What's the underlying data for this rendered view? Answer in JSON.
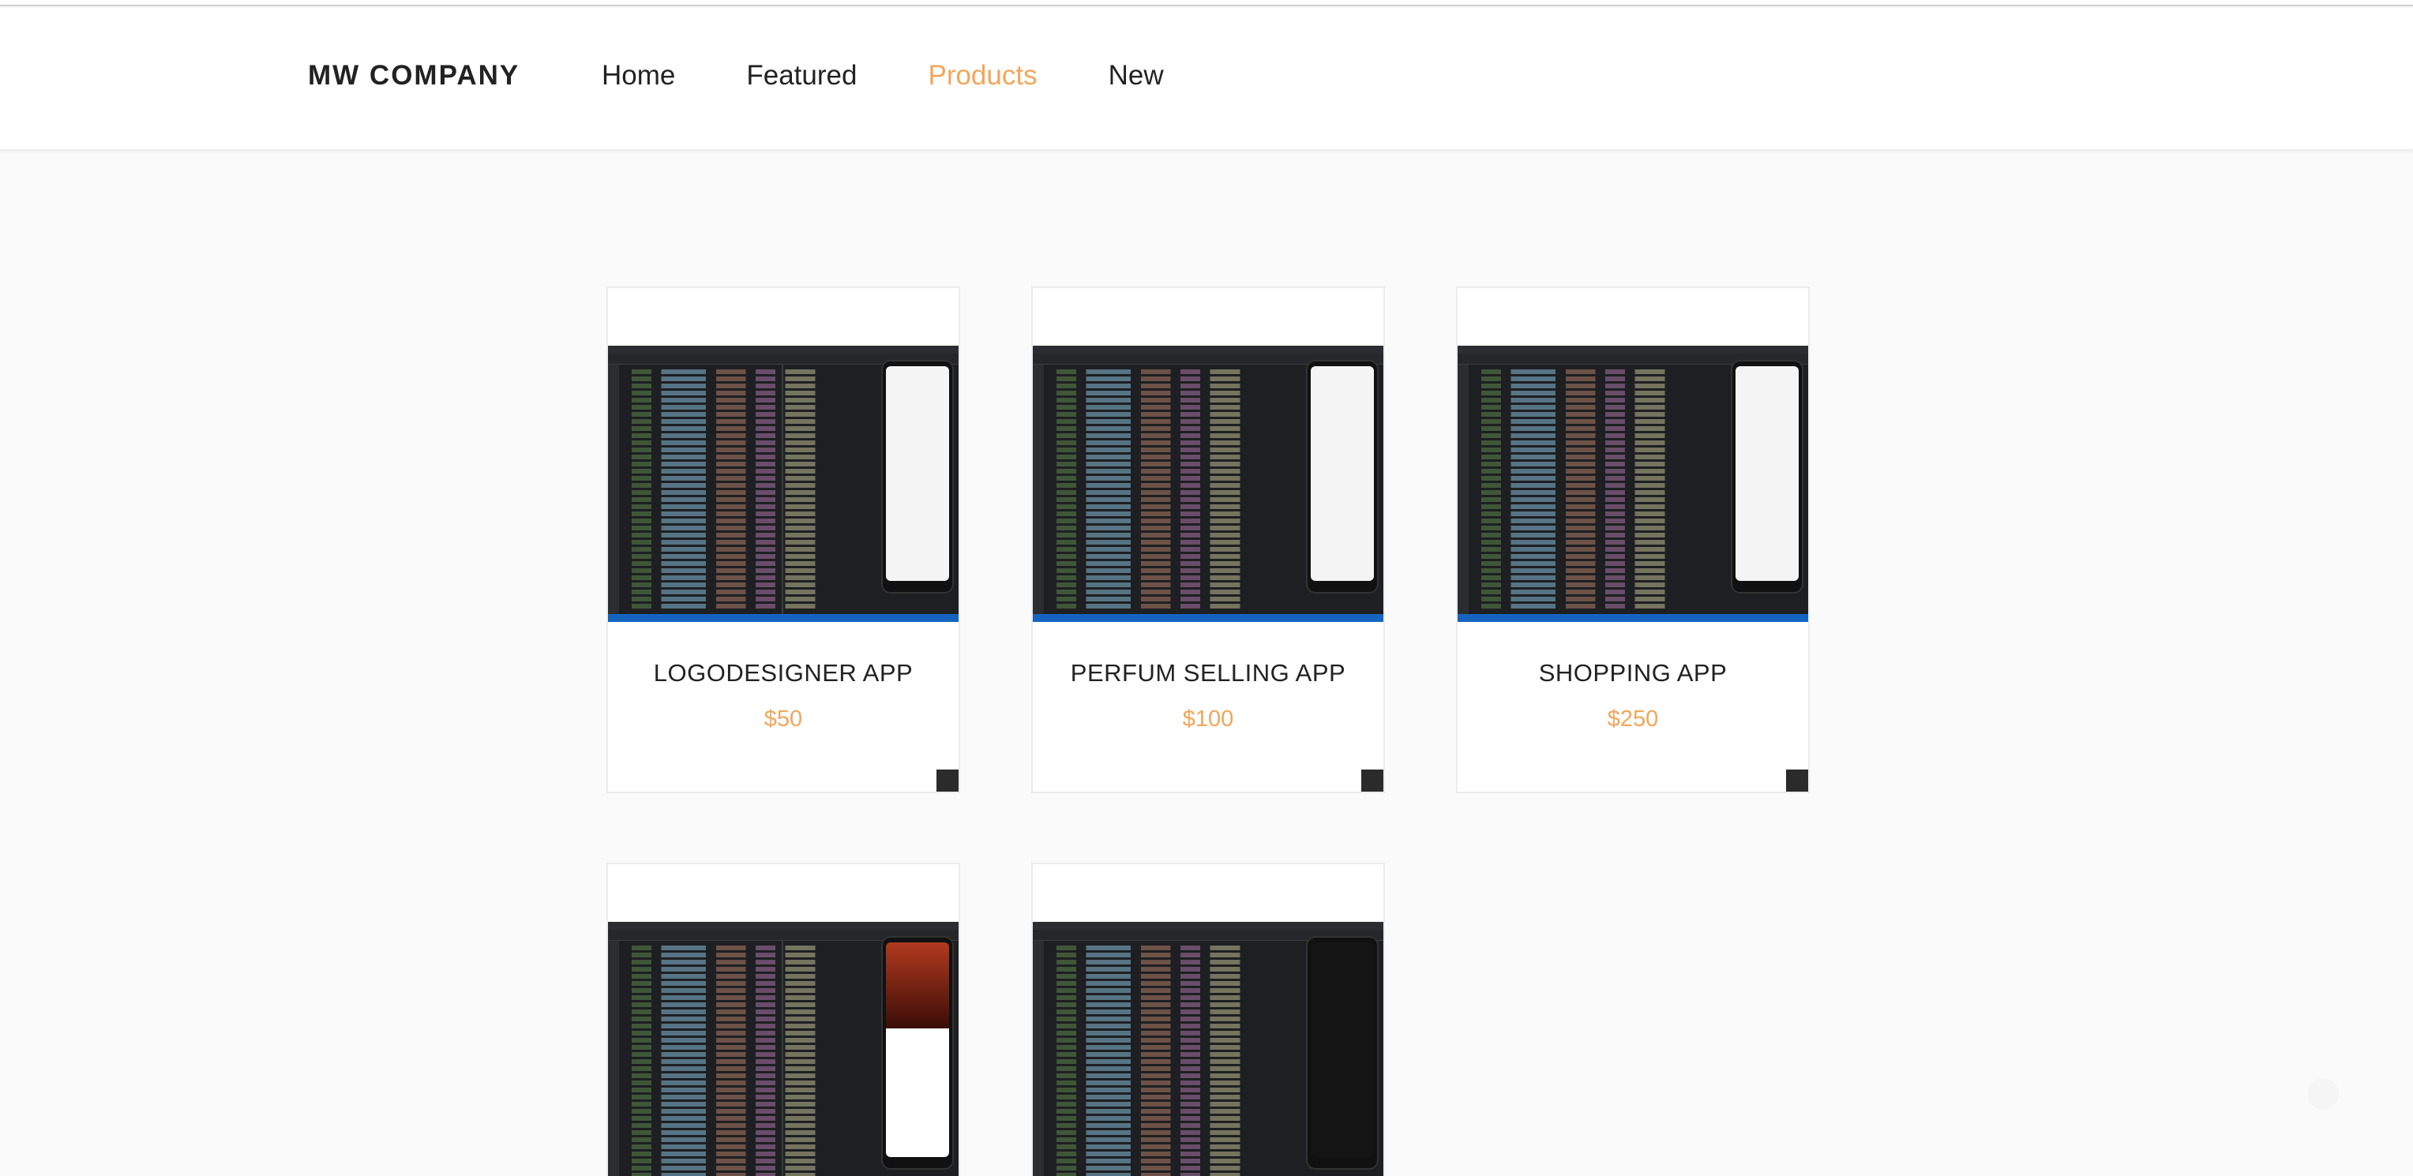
{
  "header": {
    "brand": "MW COMPANY",
    "nav": [
      {
        "label": "Home",
        "active": false
      },
      {
        "label": "Featured",
        "active": false
      },
      {
        "label": "Products",
        "active": true
      },
      {
        "label": "New",
        "active": false
      }
    ]
  },
  "accent_color": "#f2a65a",
  "products": [
    {
      "title": "LOGODESIGNER APP",
      "price": "$50",
      "thumbnail": "code-editor-with-phone-preview"
    },
    {
      "title": "PERFUM SELLING APP",
      "price": "$100",
      "thumbnail": "code-editor-with-phone-preview"
    },
    {
      "title": "SHOPPING APP",
      "price": "$250",
      "thumbnail": "code-editor-with-phone-preview"
    },
    {
      "title": "",
      "price": "",
      "thumbnail": "code-editor-with-phone-preview"
    },
    {
      "title": "",
      "price": "",
      "thumbnail": "code-editor-with-phone-preview"
    }
  ]
}
